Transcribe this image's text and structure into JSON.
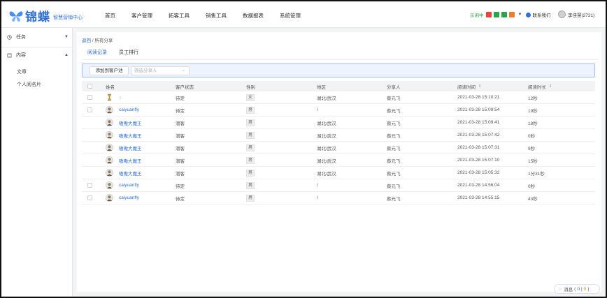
{
  "app": {
    "logo_text": "锦蝶",
    "logo_sub": "智慧营销中心",
    "logo_sub_suffix": "·",
    "accent": "#2f6fd6"
  },
  "nav": {
    "items": [
      "首页",
      "客户管理",
      "拓客工具",
      "销售工具",
      "数据报表",
      "系统管理"
    ]
  },
  "topright": {
    "status": "示闲中",
    "contact": "联系我们",
    "user": "李佳慧(2721)",
    "status_icons": [
      {
        "name": "red-status-icon",
        "color": "#e8453c"
      },
      {
        "name": "green-status-icon",
        "color": "#2aa34a"
      },
      {
        "name": "green-status-icon-2",
        "color": "#2aa34a"
      },
      {
        "name": "orange-status-icon",
        "color": "#f07a2b"
      }
    ]
  },
  "sidebar": {
    "groups": [
      {
        "label": "任务",
        "icon": "task-icon"
      },
      {
        "label": "内容",
        "icon": "content-icon"
      }
    ],
    "subitems": [
      "文章",
      "个人阅名片"
    ]
  },
  "breadcrumb": {
    "root": "返回",
    "sep": " / ",
    "current": "所有分享"
  },
  "tabs": [
    {
      "label": "阅读记录",
      "active": true
    },
    {
      "label": "员工排行",
      "active": false
    }
  ],
  "filters": {
    "add_button": "添加到客户池",
    "select_placeholder": "筛选分享人"
  },
  "table": {
    "columns": [
      "姓名",
      "客户状态",
      "性别",
      "地区",
      "分享人",
      "阅读时间",
      "阅读时长"
    ],
    "sort_icon": "⇕",
    "rows": [
      {
        "checkbox": true,
        "avatar": "hourglass-avatar-icon",
        "name": "..",
        "status": "待定",
        "gender": "女",
        "region": "湖北/武汉",
        "sharer": "蔡元飞",
        "time": "2021-03-28 15:10:21",
        "duration": "12秒"
      },
      {
        "checkbox": true,
        "avatar": "user-avatar-icon",
        "name": "caiyuanfly",
        "status": "待定",
        "gender": "男",
        "region": "/",
        "sharer": "蔡元飞",
        "time": "2021-03-28 15:09:54",
        "duration": "19秒"
      },
      {
        "checkbox": false,
        "avatar": "user-avatar-icon",
        "name": "嗷嗷大魔王",
        "status": "潜客",
        "gender": "男",
        "region": "湖北/武汉",
        "sharer": "蔡元飞",
        "time": "2021-03-28 15:09:41",
        "duration": "18秒"
      },
      {
        "checkbox": false,
        "avatar": "user-avatar-icon",
        "name": "嗷嗷大魔王",
        "status": "潜客",
        "gender": "男",
        "region": "湖北/武汉",
        "sharer": "蔡元飞",
        "time": "2021-03-28 15:07:42",
        "duration": "0秒"
      },
      {
        "checkbox": false,
        "avatar": "user-avatar-icon",
        "name": "嗷嗷大魔王",
        "status": "潜客",
        "gender": "男",
        "region": "湖北/武汉",
        "sharer": "蔡元飞",
        "time": "2021-03-28 15:07:31",
        "duration": "9秒"
      },
      {
        "checkbox": false,
        "avatar": "user-avatar-icon",
        "name": "嗷嗷大魔王",
        "status": "潜客",
        "gender": "男",
        "region": "湖北/武汉",
        "sharer": "蔡元飞",
        "time": "2021-03-28 15:07:10",
        "duration": "15秒"
      },
      {
        "checkbox": false,
        "avatar": "user-avatar-icon",
        "name": "嗷嗷大魔王",
        "status": "潜客",
        "gender": "男",
        "region": "湖北/武汉",
        "sharer": "蔡元飞",
        "time": "2021-03-28 15:05:32",
        "duration": "1分31秒"
      },
      {
        "checkbox": true,
        "avatar": "user-avatar-icon",
        "name": "caiyuanfly",
        "status": "待定",
        "gender": "男",
        "region": "/",
        "sharer": "蔡元飞",
        "time": "2021-03-28 14:56:04",
        "duration": "0秒"
      },
      {
        "checkbox": true,
        "avatar": "user-avatar-icon",
        "name": "caiyuanfly",
        "status": "待定",
        "gender": "男",
        "region": "/",
        "sharer": "蔡元飞",
        "time": "2021-03-28 14:55:15",
        "duration": "43秒"
      }
    ]
  },
  "messages": {
    "label": "消息",
    "open_paren": "(",
    "count_a": "0",
    "sep": "|",
    "count_b": "0",
    "close_paren": ")"
  }
}
